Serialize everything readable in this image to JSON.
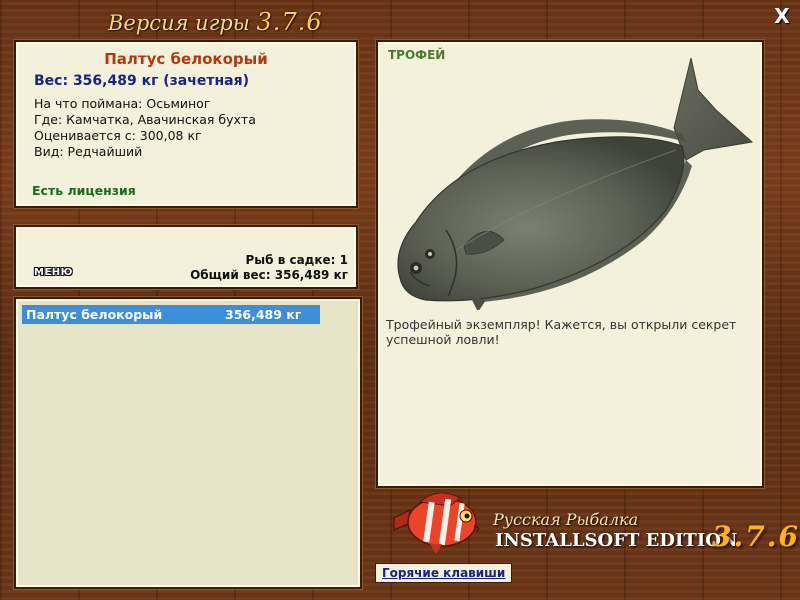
{
  "window": {
    "title": "Версия игры",
    "version": "3.7.6",
    "close_label": "X"
  },
  "fish_info": {
    "name": "Палтус белокорый",
    "weight": "Вес: 356,489 кг (зачетная)",
    "caught_on": "На что поймана: Осьминог",
    "location": "Где: Камчатка, Авачинская бухта",
    "rated_from": "Оценивается с: 300,08 кг",
    "rarity": "Вид: Редчайший",
    "license": "Есть лицензия"
  },
  "keepnet": {
    "menu_label": "МЕНЮ",
    "count": "Рыб в садке: 1",
    "total": "Общий вес: 356,489 кг"
  },
  "catch_list": [
    {
      "name": "Палтус белокорый",
      "weight": "356,489 кг"
    }
  ],
  "trophy": {
    "label": "ТРОФЕЙ",
    "text": "Трофейный экземпляр! Кажется, вы открыли секрет успешной ловли!",
    "image_icon": "halibut-image"
  },
  "brand": {
    "line1": "Русская Рыбалка",
    "line2": "INSTALLSOFT EDITION",
    "version": "3.7.6",
    "logo_icon": "red-striped-fish-logo"
  },
  "hotkeys_label": "Горячие клавиши",
  "colors": {
    "accent_title": "#b4380e",
    "weight_text": "#1a237e",
    "license_text": "#1b6b1b",
    "selection": "#3d8ddc",
    "panel_bg": "#f3f1dc",
    "brand_version": "#ffb21a"
  }
}
